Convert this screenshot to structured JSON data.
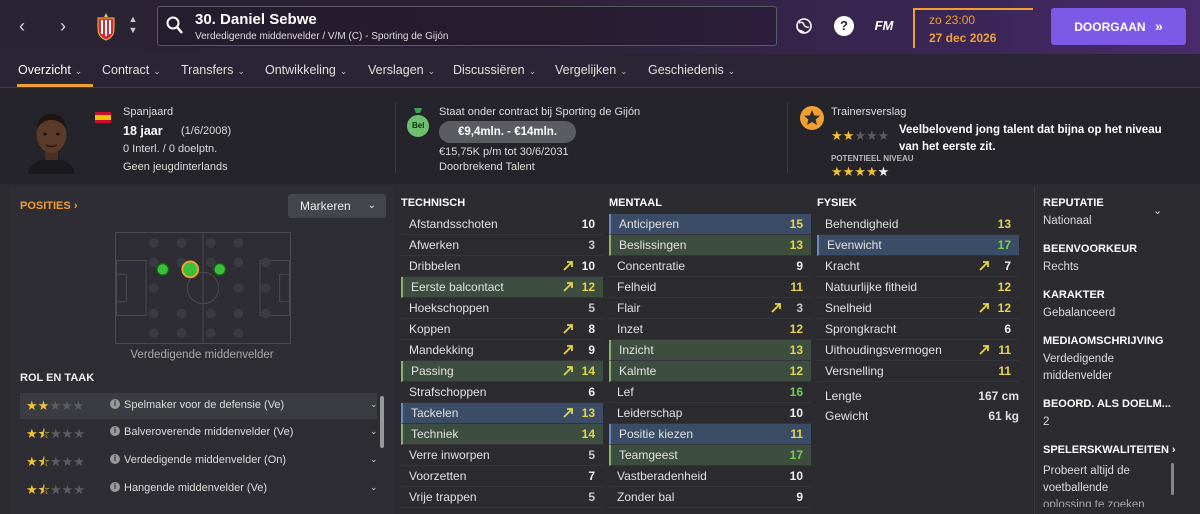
{
  "player": {
    "title": "30. Daniel Sebwe",
    "subtitle": "Verdedigende middenvelder / V/M (C) - Sporting de Gijón"
  },
  "topbar": {
    "fm_label": "FM",
    "help_label": "?",
    "date_time": "zo 23:00",
    "date_day": "27 dec 2026",
    "continue_label": "DOORGAAN",
    "continue_icon": "»",
    "accent_color": "#f0a030",
    "button_color": "#7c5ae6"
  },
  "tabs": [
    {
      "label": "Overzicht"
    },
    {
      "label": "Contract"
    },
    {
      "label": "Transfers"
    },
    {
      "label": "Ontwikkeling"
    },
    {
      "label": "Verslagen"
    },
    {
      "label": "Discussiëren"
    },
    {
      "label": "Vergelijken"
    },
    {
      "label": "Geschiedenis"
    }
  ],
  "profile": {
    "nationality": "Spanjaard",
    "age": "18 jaar",
    "birth": "(1/6/2008)",
    "caps": "0 Interl. / 0 doelptn.",
    "youth": "Geen jeugdinterlands"
  },
  "contract": {
    "bag_label": "Bel",
    "status": "Staat onder contract bij Sporting de Gijón",
    "value": "€9,4mln. - €14mln.",
    "wage": "€15,75K p/m tot 30/6/2031",
    "label": "Doorbrekend Talent"
  },
  "scout": {
    "title": "Trainersverslag",
    "ability_stars": 2,
    "text": "Veelbelovend jong talent dat bijna op het niveau van het eerste zit.",
    "potential_label": "POTENTIEEL NIVEAU",
    "potential_stars": 4.5
  },
  "positions": {
    "title": "POSITIES",
    "mark_button": "Markeren",
    "pitch_label": "Verdedigende middenvelder"
  },
  "roles": {
    "title": "ROL EN TAAK",
    "items": [
      {
        "name": "Spelmaker voor de defensie (Ve)",
        "stars": 2
      },
      {
        "name": "Balveroverende middenvelder (Ve)",
        "stars": 1.5
      },
      {
        "name": "Verdedigende middenvelder (On)",
        "stars": 1.5
      },
      {
        "name": "Hangende middenvelder (Ve)",
        "stars": 1.5
      }
    ]
  },
  "technical": {
    "title": "TECHNISCH",
    "rows": [
      {
        "name": "Afstandsschoten",
        "value": "10",
        "hl": "",
        "vc": "white",
        "arrow": false
      },
      {
        "name": "Afwerken",
        "value": "3",
        "hl": "",
        "vc": "gray",
        "arrow": false
      },
      {
        "name": "Dribbelen",
        "value": "10",
        "hl": "",
        "vc": "white",
        "arrow": true
      },
      {
        "name": "Eerste balcontact",
        "value": "12",
        "hl": "green",
        "vc": "yellow",
        "arrow": true
      },
      {
        "name": "Hoekschoppen",
        "value": "5",
        "hl": "",
        "vc": "gray",
        "arrow": false
      },
      {
        "name": "Koppen",
        "value": "8",
        "hl": "",
        "vc": "white",
        "arrow": true
      },
      {
        "name": "Mandekking",
        "value": "9",
        "hl": "",
        "vc": "white",
        "arrow": true
      },
      {
        "name": "Passing",
        "value": "14",
        "hl": "green",
        "vc": "yellow",
        "arrow": true
      },
      {
        "name": "Strafschoppen",
        "value": "6",
        "hl": "",
        "vc": "white",
        "arrow": false
      },
      {
        "name": "Tackelen",
        "value": "13",
        "hl": "blue",
        "vc": "yellow",
        "arrow": true
      },
      {
        "name": "Techniek",
        "value": "14",
        "hl": "green",
        "vc": "yellow",
        "arrow": false
      },
      {
        "name": "Verre inworpen",
        "value": "5",
        "hl": "",
        "vc": "gray",
        "arrow": false
      },
      {
        "name": "Voorzetten",
        "value": "7",
        "hl": "",
        "vc": "white",
        "arrow": false
      },
      {
        "name": "Vrije trappen",
        "value": "5",
        "hl": "",
        "vc": "gray",
        "arrow": false
      }
    ]
  },
  "mental": {
    "title": "MENTAAL",
    "rows": [
      {
        "name": "Anticiperen",
        "value": "15",
        "hl": "blue",
        "vc": "yellow",
        "arrow": false
      },
      {
        "name": "Beslissingen",
        "value": "13",
        "hl": "green",
        "vc": "yellow",
        "arrow": false
      },
      {
        "name": "Concentratie",
        "value": "9",
        "hl": "",
        "vc": "white",
        "arrow": false
      },
      {
        "name": "Felheid",
        "value": "11",
        "hl": "",
        "vc": "yellow",
        "arrow": false
      },
      {
        "name": "Flair",
        "value": "3",
        "hl": "",
        "vc": "gray",
        "arrow": true
      },
      {
        "name": "Inzet",
        "value": "12",
        "hl": "",
        "vc": "yellow",
        "arrow": false
      },
      {
        "name": "Inzicht",
        "value": "13",
        "hl": "green",
        "vc": "yellow",
        "arrow": false
      },
      {
        "name": "Kalmte",
        "value": "12",
        "hl": "green",
        "vc": "yellow",
        "arrow": false
      },
      {
        "name": "Lef",
        "value": "16",
        "hl": "",
        "vc": "green",
        "arrow": false
      },
      {
        "name": "Leiderschap",
        "value": "10",
        "hl": "",
        "vc": "white",
        "arrow": false
      },
      {
        "name": "Positie kiezen",
        "value": "11",
        "hl": "blue",
        "vc": "yellow",
        "arrow": false
      },
      {
        "name": "Teamgeest",
        "value": "17",
        "hl": "green",
        "vc": "green",
        "arrow": false
      },
      {
        "name": "Vastberadenheid",
        "value": "10",
        "hl": "",
        "vc": "white",
        "arrow": false
      },
      {
        "name": "Zonder bal",
        "value": "9",
        "hl": "",
        "vc": "white",
        "arrow": false
      }
    ]
  },
  "physical": {
    "title": "FYSIEK",
    "rows": [
      {
        "name": "Behendigheid",
        "value": "13",
        "hl": "",
        "vc": "yellow",
        "arrow": false
      },
      {
        "name": "Evenwicht",
        "value": "17",
        "hl": "blue",
        "vc": "green",
        "arrow": false
      },
      {
        "name": "Kracht",
        "value": "7",
        "hl": "",
        "vc": "white",
        "arrow": true
      },
      {
        "name": "Natuurlijke fitheid",
        "value": "12",
        "hl": "",
        "vc": "yellow",
        "arrow": false
      },
      {
        "name": "Snelheid",
        "value": "12",
        "hl": "",
        "vc": "yellow",
        "arrow": true
      },
      {
        "name": "Sprongkracht",
        "value": "6",
        "hl": "",
        "vc": "white",
        "arrow": false
      },
      {
        "name": "Uithoudingsvermogen",
        "value": "11",
        "hl": "",
        "vc": "yellow",
        "arrow": true
      },
      {
        "name": "Versnelling",
        "value": "11",
        "hl": "",
        "vc": "yellow",
        "arrow": false
      }
    ],
    "length_label": "Lengte",
    "length_value": "167 cm",
    "weight_label": "Gewicht",
    "weight_value": "61 kg"
  },
  "sidebar": {
    "reputation_title": "REPUTATIE",
    "reputation_value": "Nationaal",
    "foot_title": "BEENVOORKEUR",
    "foot_value": "Rechts",
    "character_title": "KARAKTER",
    "character_value": "Gebalanceerd",
    "media_title": "MEDIAOMSCHRIJVING",
    "media_value_1": "Verdedigende",
    "media_value_2": "middenvelder",
    "gk_title": "BEOORD. ALS DOELM...",
    "gk_value": "2",
    "traits_title": "SPELERSKWALITEITEN",
    "traits_value_1": "Probeert altijd de",
    "traits_value_2": "voetballende",
    "traits_value_3": "oplossing te zoeken"
  },
  "value_colors": {
    "white": "#f0f0f0",
    "gray": "#c8c8c8",
    "yellow": "#e6d44a",
    "green": "#6fd34a"
  }
}
